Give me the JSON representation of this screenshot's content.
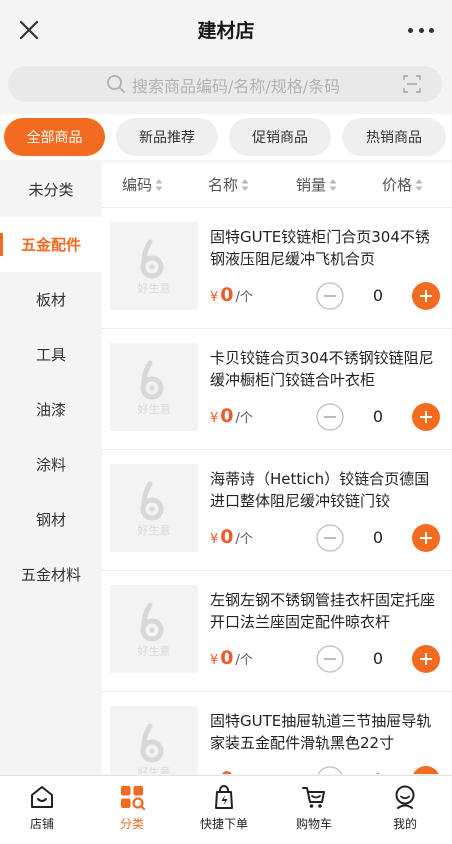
{
  "header": {
    "title": "建材店"
  },
  "search": {
    "placeholder": "搜索商品编码/名称/规格/条码"
  },
  "categories": [
    {
      "label": "全部商品",
      "active": true
    },
    {
      "label": "新品推荐",
      "active": false
    },
    {
      "label": "促销商品",
      "active": false
    },
    {
      "label": "热销商品",
      "active": false
    }
  ],
  "sidebar": {
    "items": [
      {
        "label": "未分类",
        "active": false
      },
      {
        "label": "五金配件",
        "active": true
      },
      {
        "label": "板材",
        "active": false
      },
      {
        "label": "工具",
        "active": false
      },
      {
        "label": "油漆",
        "active": false
      },
      {
        "label": "涂料",
        "active": false
      },
      {
        "label": "钢材",
        "active": false
      },
      {
        "label": "五金材料",
        "active": false
      }
    ]
  },
  "sort": {
    "code": "编码",
    "name": "名称",
    "sales": "销量",
    "price": "价格"
  },
  "thumb_logo_text": "好生意",
  "products": [
    {
      "name": "固特GUTE铰链柜门合页304不锈钢液压阻尼缓冲飞机合页",
      "currency": "¥",
      "price": "0",
      "unit": "/个",
      "qty": "0"
    },
    {
      "name": "卡贝铰链合页304不锈钢铰链阻尼缓冲橱柜门铰链合叶衣柜",
      "currency": "¥",
      "price": "0",
      "unit": "/个",
      "qty": "0"
    },
    {
      "name": "海蒂诗（Hettich）铰链合页德国进口整体阻尼缓冲铰链门铰",
      "currency": "¥",
      "price": "0",
      "unit": "/个",
      "qty": "0"
    },
    {
      "name": "左钢左钢不锈钢管挂衣杆固定托座开口法兰座固定配件晾衣杆",
      "currency": "¥",
      "price": "0",
      "unit": "/个",
      "qty": "0"
    },
    {
      "name": "固特GUTE抽屉轨道三节抽屉导轨家装五金配件滑轨黑色22寸",
      "currency": "¥",
      "price": "0",
      "unit": "/个",
      "qty": "0"
    }
  ],
  "tabbar": {
    "items": [
      {
        "label": "店铺",
        "icon": "store-icon",
        "active": false
      },
      {
        "label": "分类",
        "icon": "category-grid-icon",
        "active": true
      },
      {
        "label": "快捷下单",
        "icon": "quick-order-icon",
        "active": false
      },
      {
        "label": "购物车",
        "icon": "cart-icon",
        "active": false
      },
      {
        "label": "我的",
        "icon": "profile-icon",
        "active": false
      }
    ]
  },
  "colors": {
    "accent": "#f36b21",
    "price": "#f05a28"
  }
}
